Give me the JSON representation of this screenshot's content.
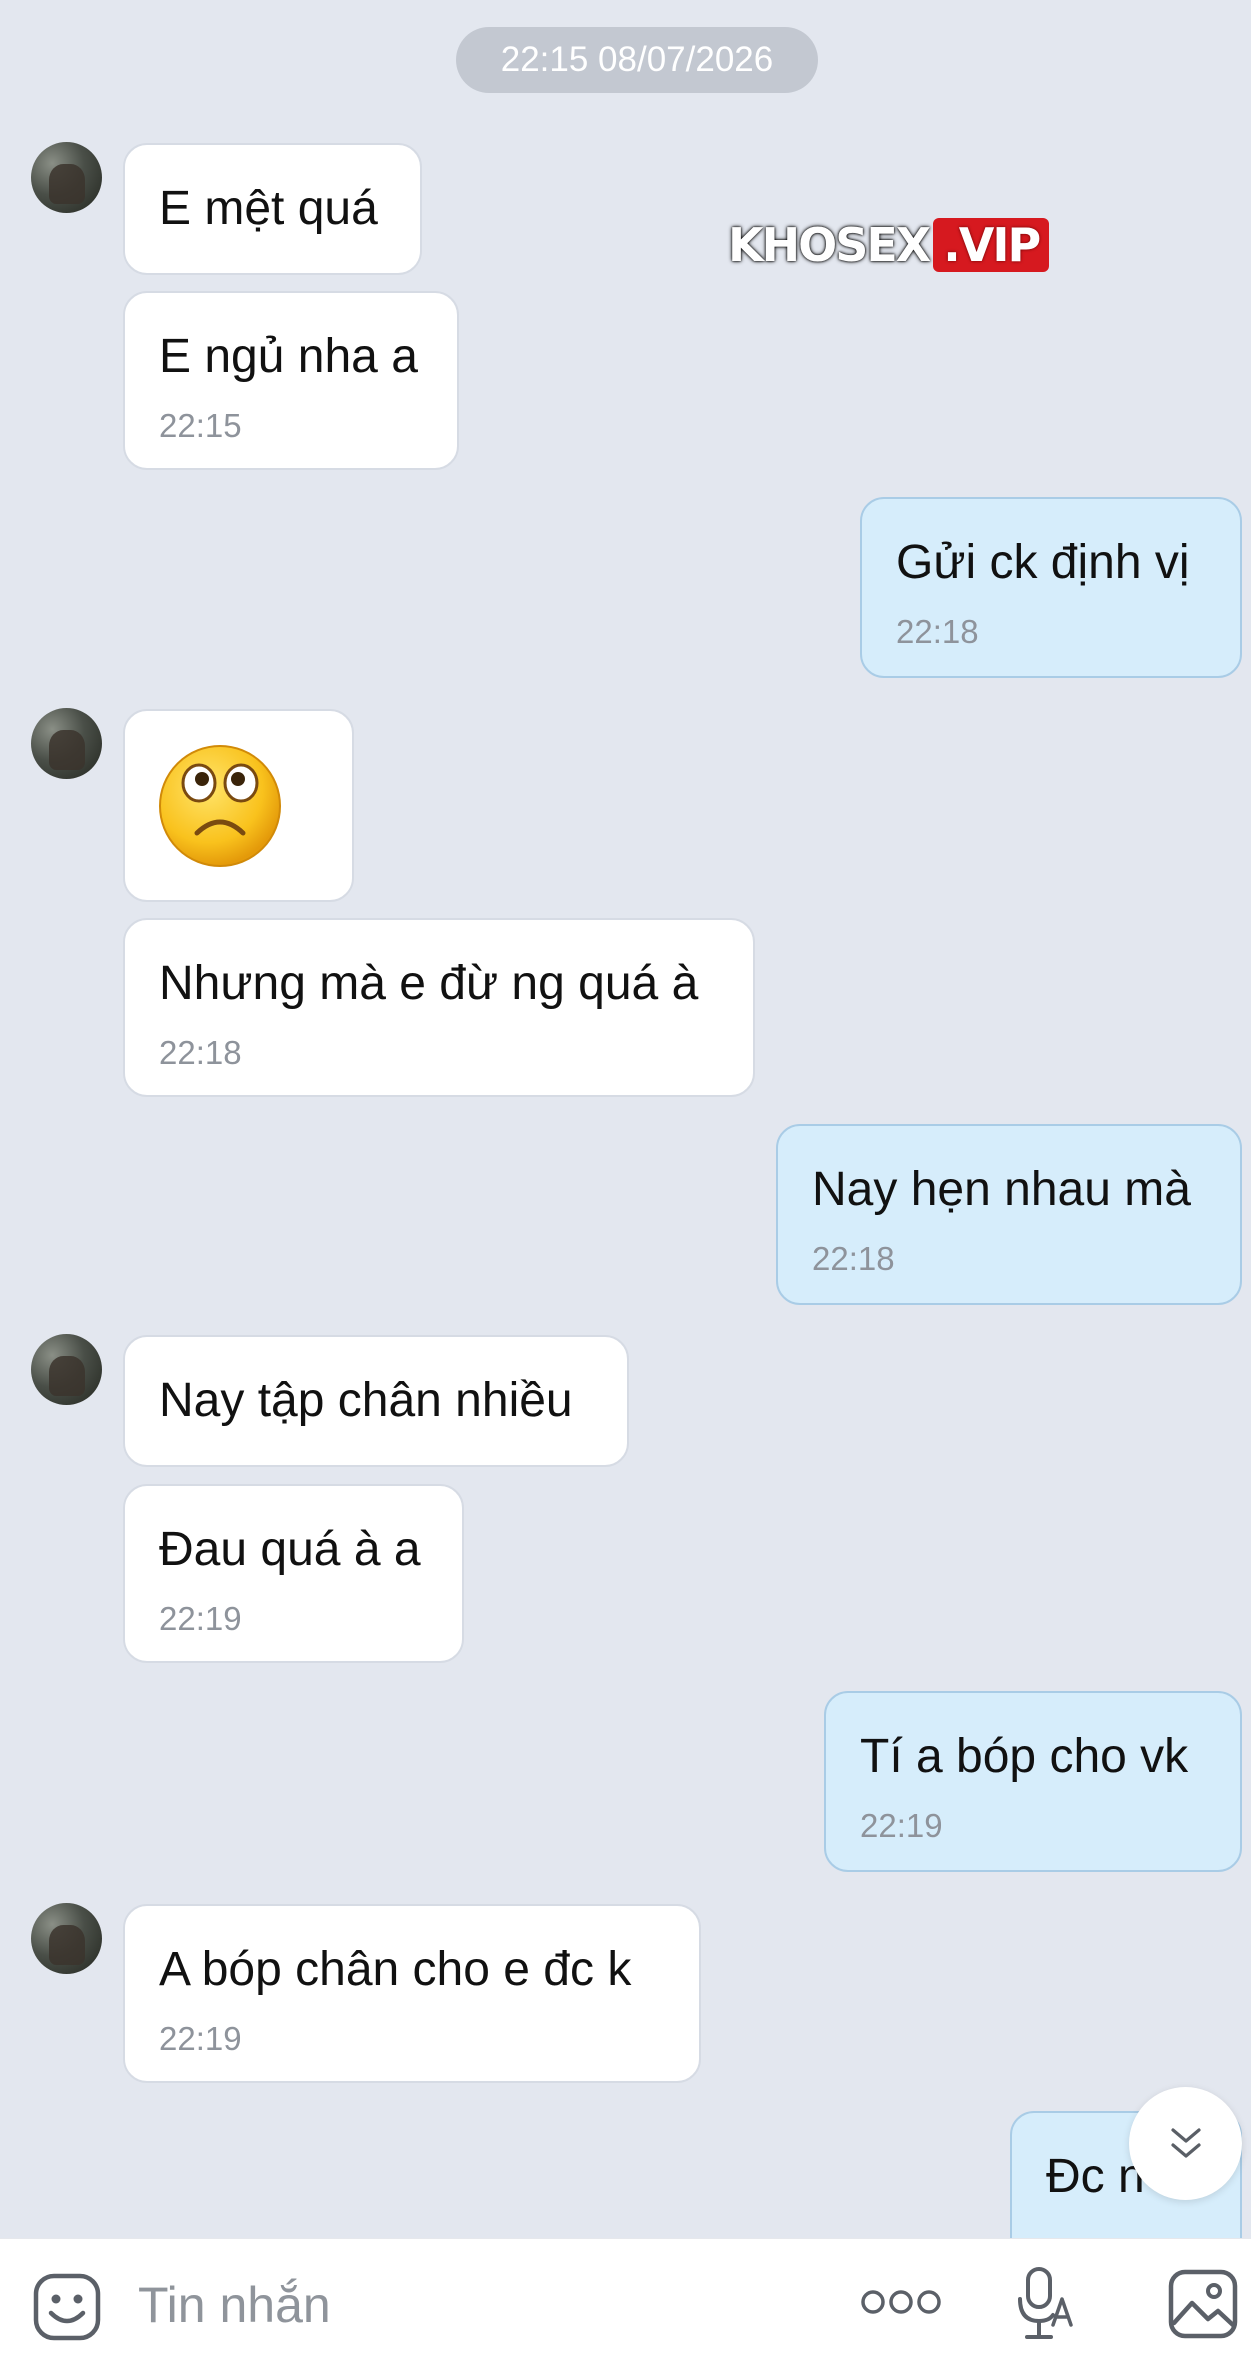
{
  "date_header": "22:15 08/07/2026",
  "watermark": {
    "main": "KHOSEX",
    "suffix": ".VIP"
  },
  "messages": [
    {
      "text": "E mệt quá",
      "time": ""
    },
    {
      "text": "E ngủ nha a",
      "time": "22:15"
    },
    {
      "text": "Gửi ck định vị",
      "time": "22:18"
    },
    {
      "text": "",
      "time": ""
    },
    {
      "text": "Nhưng mà e đừ ng quá à",
      "time": "22:18"
    },
    {
      "text": "Nay hẹn nhau mà",
      "time": "22:18"
    },
    {
      "text": "Nay tập chân nhiều",
      "time": ""
    },
    {
      "text": "Đau quá à a",
      "time": "22:19"
    },
    {
      "text": "Tí a bóp cho vk",
      "time": "22:19"
    },
    {
      "text": "A bóp chân cho e đc k",
      "time": "22:19"
    },
    {
      "text": "Đc n",
      "time": ""
    }
  ],
  "sticker": "sad-face-emoji",
  "input_bar": {
    "placeholder": "Tin nhắn",
    "icons": [
      "sticker-icon",
      "more-options-icon",
      "voice-to-text-icon",
      "image-icon"
    ]
  },
  "colors": {
    "background": "#e3e7ef",
    "incoming_bubble": "#ffffff",
    "outgoing_bubble": "#d6edfb",
    "timestamp": "#8e939b"
  }
}
